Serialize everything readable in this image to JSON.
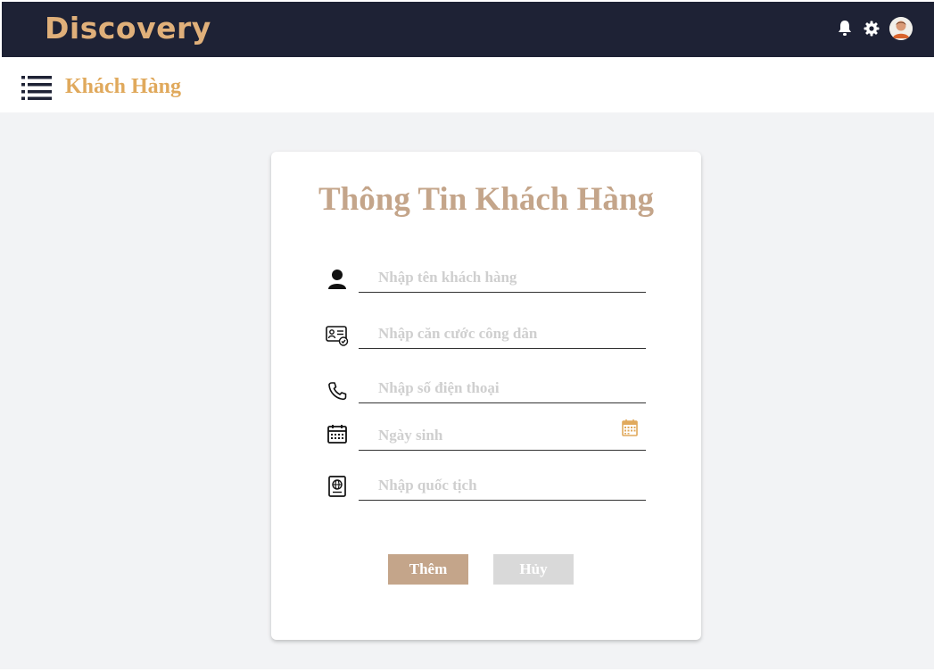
{
  "app": {
    "brand": "Discovery"
  },
  "header": {
    "page_title": "Khách Hàng"
  },
  "form": {
    "title": "Thông Tin Khách Hàng",
    "fields": [
      {
        "icon": "user-icon",
        "value": "",
        "placeholder": "Nhập tên khách hàng"
      },
      {
        "icon": "id-card-icon",
        "value": "",
        "placeholder": "Nhập căn cước công dân"
      },
      {
        "icon": "phone-icon",
        "value": "",
        "placeholder": "Nhập số điện thoại"
      },
      {
        "icon": "calendar-icon",
        "value": "",
        "placeholder": "Ngày sinh"
      },
      {
        "icon": "passport-icon",
        "value": "",
        "placeholder": "Nhập quốc tịch"
      }
    ],
    "add_label": "Thêm",
    "cancel_label": "Hủy"
  },
  "colors": {
    "topbar": "#1e2235",
    "brand": "#e0b07a",
    "page_title": "#e0a95c",
    "accent": "#c4a58a",
    "cancel": "#d9d9d9",
    "background": "#f2f3f5"
  }
}
